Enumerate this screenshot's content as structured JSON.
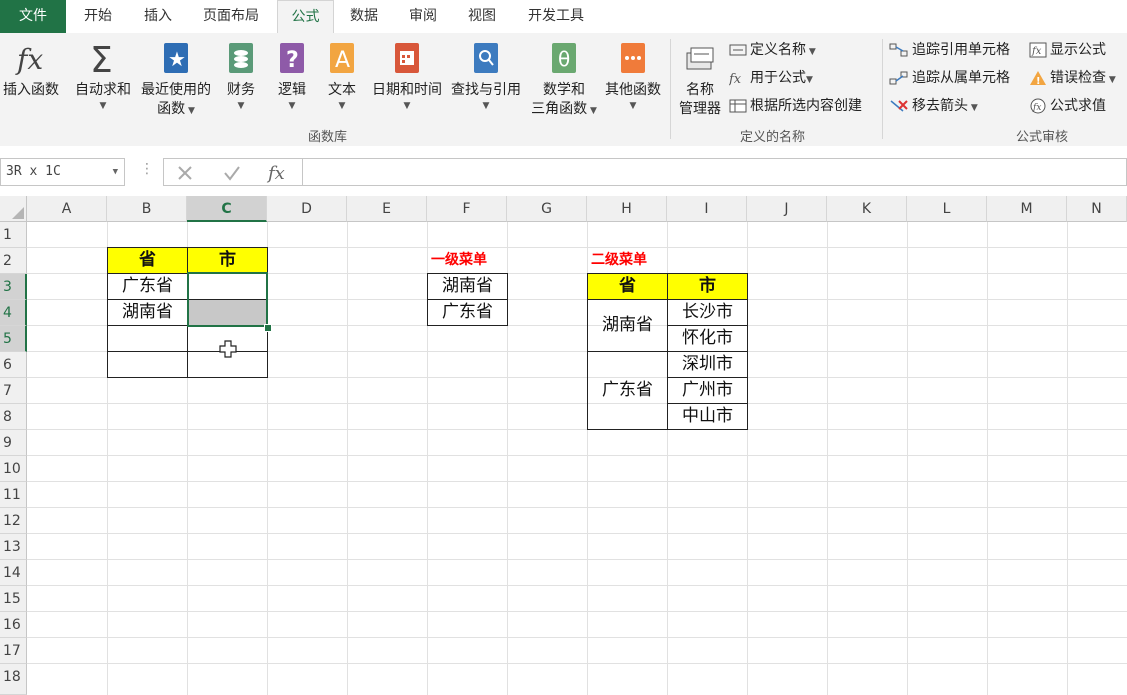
{
  "tabs": [
    "文件",
    "开始",
    "插入",
    "页面布局",
    "公式",
    "数据",
    "审阅",
    "视图",
    "开发工具"
  ],
  "active_tab": "公式",
  "ribbon": {
    "insert_function": "插入函数",
    "autosum": "自动求和",
    "recent_1": "最近使用的",
    "recent_2": "函数",
    "finance": "财务",
    "logic": "逻辑",
    "text": "文本",
    "datetime": "日期和时间",
    "lookup": "查找与引用",
    "math_1": "数学和",
    "math_2": "三角函数",
    "other": "其他函数",
    "library_label": "函数库",
    "name_mgr_1": "名称",
    "name_mgr_2": "管理器",
    "define_name": "定义名称",
    "use_in_formula": "用于公式",
    "create_from_sel": "根据所选内容创建",
    "defined_names_label": "定义的名称",
    "trace_precedents": "追踪引用单元格",
    "trace_dependents": "追踪从属单元格",
    "remove_arrows": "移去箭头",
    "show_formulas": "显示公式",
    "error_check": "错误检查",
    "evaluate": "公式求值",
    "audit_label": "公式审核",
    "icon_colors": {
      "finance": "#5a9a78",
      "logic": "#8e5aa8",
      "text": "#f2a541",
      "datetime": "#d8573a",
      "lookup": "#3d7bbf",
      "math": "#6aa870",
      "other": "#f07b3a",
      "recent": "#2e6db4"
    }
  },
  "formula_bar": {
    "name_box": "3R x 1C",
    "formula": ""
  },
  "columns": [
    "A",
    "B",
    "C",
    "D",
    "E",
    "F",
    "G",
    "H",
    "I",
    "J",
    "K",
    "L",
    "M",
    "N"
  ],
  "selected_column": "C",
  "rows": [
    "1",
    "2",
    "3",
    "4",
    "5",
    "6",
    "7",
    "8",
    "9",
    "10",
    "11",
    "12",
    "13",
    "14",
    "15",
    "16",
    "17",
    "18"
  ],
  "selected_rows": [
    "3",
    "4",
    "5"
  ],
  "table1": {
    "header_province": "省",
    "header_city": "市",
    "province_row1": "广东省",
    "province_row2": "湖南省"
  },
  "menu1": {
    "title": "一级菜单",
    "item1": "湖南省",
    "item2": "广东省"
  },
  "menu2": {
    "title": "二级菜单",
    "header_province": "省",
    "header_city": "市",
    "group1": "湖南省",
    "group1_cities": [
      "长沙市",
      "怀化市"
    ],
    "group2": "广东省",
    "group2_cities": [
      "深圳市",
      "广州市",
      "中山市"
    ]
  }
}
